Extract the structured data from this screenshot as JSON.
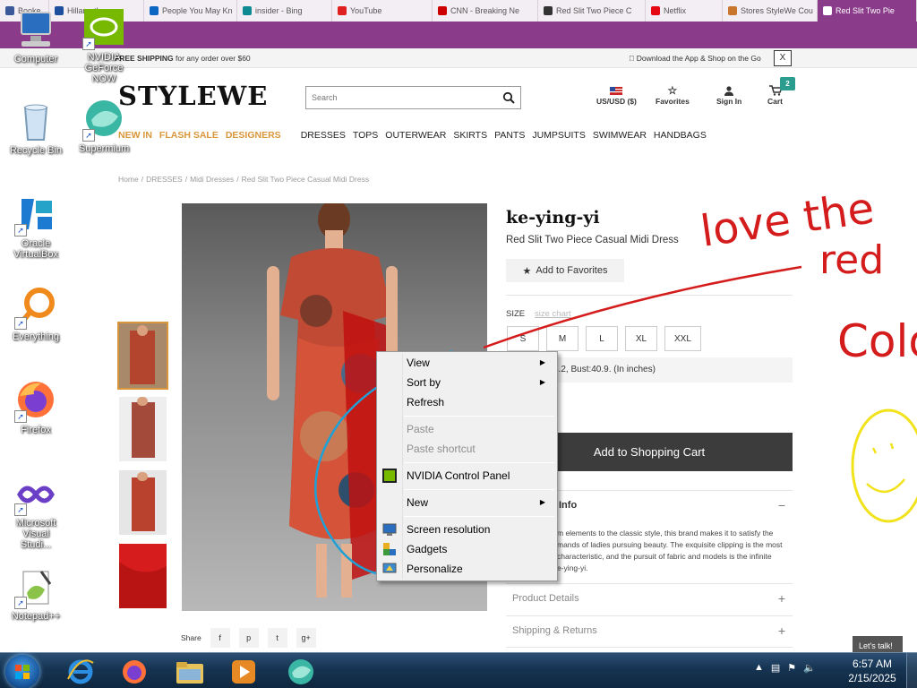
{
  "browser": {
    "tabs": [
      {
        "label": "Booke",
        "color": "#3b5998"
      },
      {
        "label": "Hillar... the",
        "color": "#1e4e9e"
      },
      {
        "label": "People You May Kn",
        "color": "#0a66c2"
      },
      {
        "label": "insider - Bing",
        "color": "#0e8a93"
      },
      {
        "label": "YouTube",
        "color": "#e02020"
      },
      {
        "label": "CNN - Breaking Ne",
        "color": "#cc0000"
      },
      {
        "label": "Red Slit Two Piece C",
        "color": "#333333"
      },
      {
        "label": "Netflix",
        "color": "#e50914"
      },
      {
        "label": "Stores StyleWe Cou",
        "color": "#c9772d"
      },
      {
        "label": "Red Slit Two Pie",
        "color": "#ffffff"
      }
    ],
    "active_tab_color": "#8a3b8a"
  },
  "site": {
    "promo": {
      "free_shipping_bold": "FREE SHIPPING",
      "free_shipping_rest": " for any order over $60",
      "app_text": "Download the App & Shop on the Go",
      "close": "X"
    },
    "logo": "STYLEWE",
    "search_placeholder": "Search",
    "header": {
      "currency": "US/USD ($)",
      "favorites": "Favorites",
      "signin": "Sign In",
      "cart": "Cart",
      "cart_count": "2"
    },
    "nav": {
      "highlight": [
        "NEW IN",
        "FLASH SALE",
        "DESIGNERS"
      ],
      "items": [
        "DRESSES",
        "TOPS",
        "OUTERWEAR",
        "SKIRTS",
        "PANTS",
        "JUMPSUITS",
        "SWIMWEAR",
        "HANDBAGS"
      ]
    },
    "breadcrumb": [
      "Home",
      "/",
      "DRESSES",
      "/",
      "Midi Dresses",
      "/",
      "Red Slit Two Piece Casual Midi Dress"
    ],
    "product": {
      "brand": "ke-ying-yi",
      "title": "Red Slit Two Piece Casual Midi Dress",
      "add_favorites": "Add to Favorites",
      "size_label": "SIZE",
      "size_chart": "size chart",
      "sizes": [
        "S",
        "M",
        "L",
        "XL",
        "XXL"
      ],
      "measure": "4.2, Bust:40.9. (In inches)",
      "add_to_cart": "Add to Shopping Cart",
      "info_title": "Info",
      "info_body": "m elements to the classic style, this brand makes it to satisfy the\nmands of ladies pursuing beauty. The exquisite clipping is the most\ncharacteristic, and the pursuit of fabric and models is the infinite\ne-ying-yi.",
      "product_details": "Product Details",
      "shipping_returns": "Shipping & Returns"
    },
    "share_label": "Share",
    "share_buttons": [
      "f",
      "p",
      "t",
      "g+"
    ]
  },
  "desktop_icons": [
    {
      "label": "Computer",
      "name": "computer-icon"
    },
    {
      "label": "NVIDIA GeForce NOW",
      "name": "nvidia-icon"
    },
    {
      "label": "Recycle Bin",
      "name": "recycle-bin-icon"
    },
    {
      "label": "Supermium",
      "name": "supermium-icon"
    },
    {
      "label": "Oracle VirtualBox",
      "name": "virtualbox-icon"
    },
    {
      "label": "Everything",
      "name": "everything-icon"
    },
    {
      "label": "Firefox",
      "name": "firefox-icon"
    },
    {
      "label": "Microsoft Visual Studi...",
      "name": "visual-studio-icon"
    },
    {
      "label": "Notepad++",
      "name": "notepadpp-icon"
    }
  ],
  "context_menu": {
    "view": "View",
    "sort_by": "Sort by",
    "refresh": "Refresh",
    "paste": "Paste",
    "paste_shortcut": "Paste shortcut",
    "nvidia": "NVIDIA Control Panel",
    "new": "New",
    "screen_resolution": "Screen resolution",
    "gadgets": "Gadgets",
    "personalize": "Personalize"
  },
  "annotations": {
    "line1": "love the",
    "line2": "red",
    "line3": "Colo",
    "ink_color": "#d41c1c",
    "smiley_color": "#f2e21a",
    "circle_color": "#1fa0d6"
  },
  "taskbar": {
    "time": "6:57 AM",
    "date": "2/15/2025",
    "lets_talk": "Let's talk!"
  }
}
